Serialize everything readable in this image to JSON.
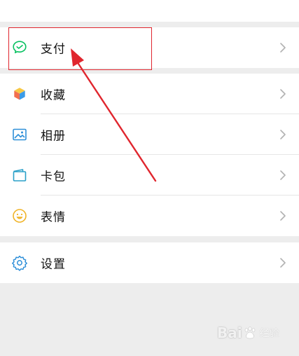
{
  "menu": {
    "pay": {
      "label": "支付",
      "icon": "wechat-pay-icon"
    },
    "items": [
      {
        "label": "收藏",
        "icon": "favorites-cube-icon"
      },
      {
        "label": "相册",
        "icon": "album-picture-icon"
      },
      {
        "label": "卡包",
        "icon": "card-wallet-icon"
      },
      {
        "label": "表情",
        "icon": "smiley-face-icon"
      }
    ],
    "settings": {
      "label": "设置",
      "icon": "settings-gear-icon"
    }
  },
  "colors": {
    "pay_icon": "#07c160",
    "annotation": "#e0262e",
    "chevron": "#b2b2b2"
  },
  "watermark": {
    "text": "Bai",
    "sub": "经验"
  }
}
